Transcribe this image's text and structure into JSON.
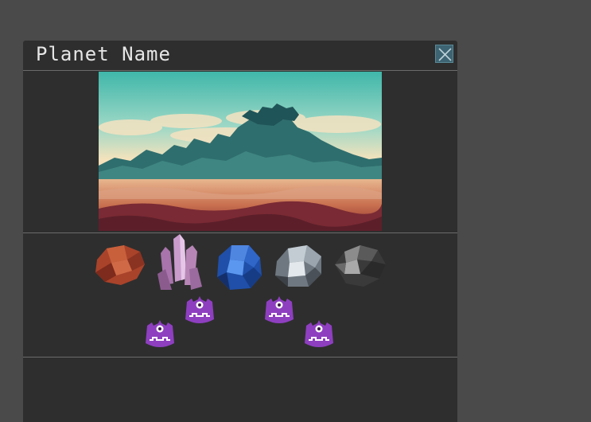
{
  "window": {
    "title": "Planet Name",
    "close_icon": "close-x-icon"
  },
  "landscape": {
    "icon": "planet-landscape-image"
  },
  "resources": [
    {
      "icon": "copper-ore-icon",
      "color": "#b04a2a"
    },
    {
      "icon": "amethyst-crystal-icon",
      "color": "#b77fb0"
    },
    {
      "icon": "sapphire-ore-icon",
      "color": "#2d63c8"
    },
    {
      "icon": "silver-ore-icon",
      "color": "#9aa5ae"
    },
    {
      "icon": "hematite-ore-icon",
      "color": "#4c4c4c"
    }
  ],
  "creatures": [
    {
      "icon": "godot-creature-icon",
      "color": "#8e3fc0"
    },
    {
      "icon": "godot-creature-icon",
      "color": "#8e3fc0"
    },
    {
      "icon": "godot-creature-icon",
      "color": "#8e3fc0"
    },
    {
      "icon": "godot-creature-icon",
      "color": "#8e3fc0"
    }
  ]
}
